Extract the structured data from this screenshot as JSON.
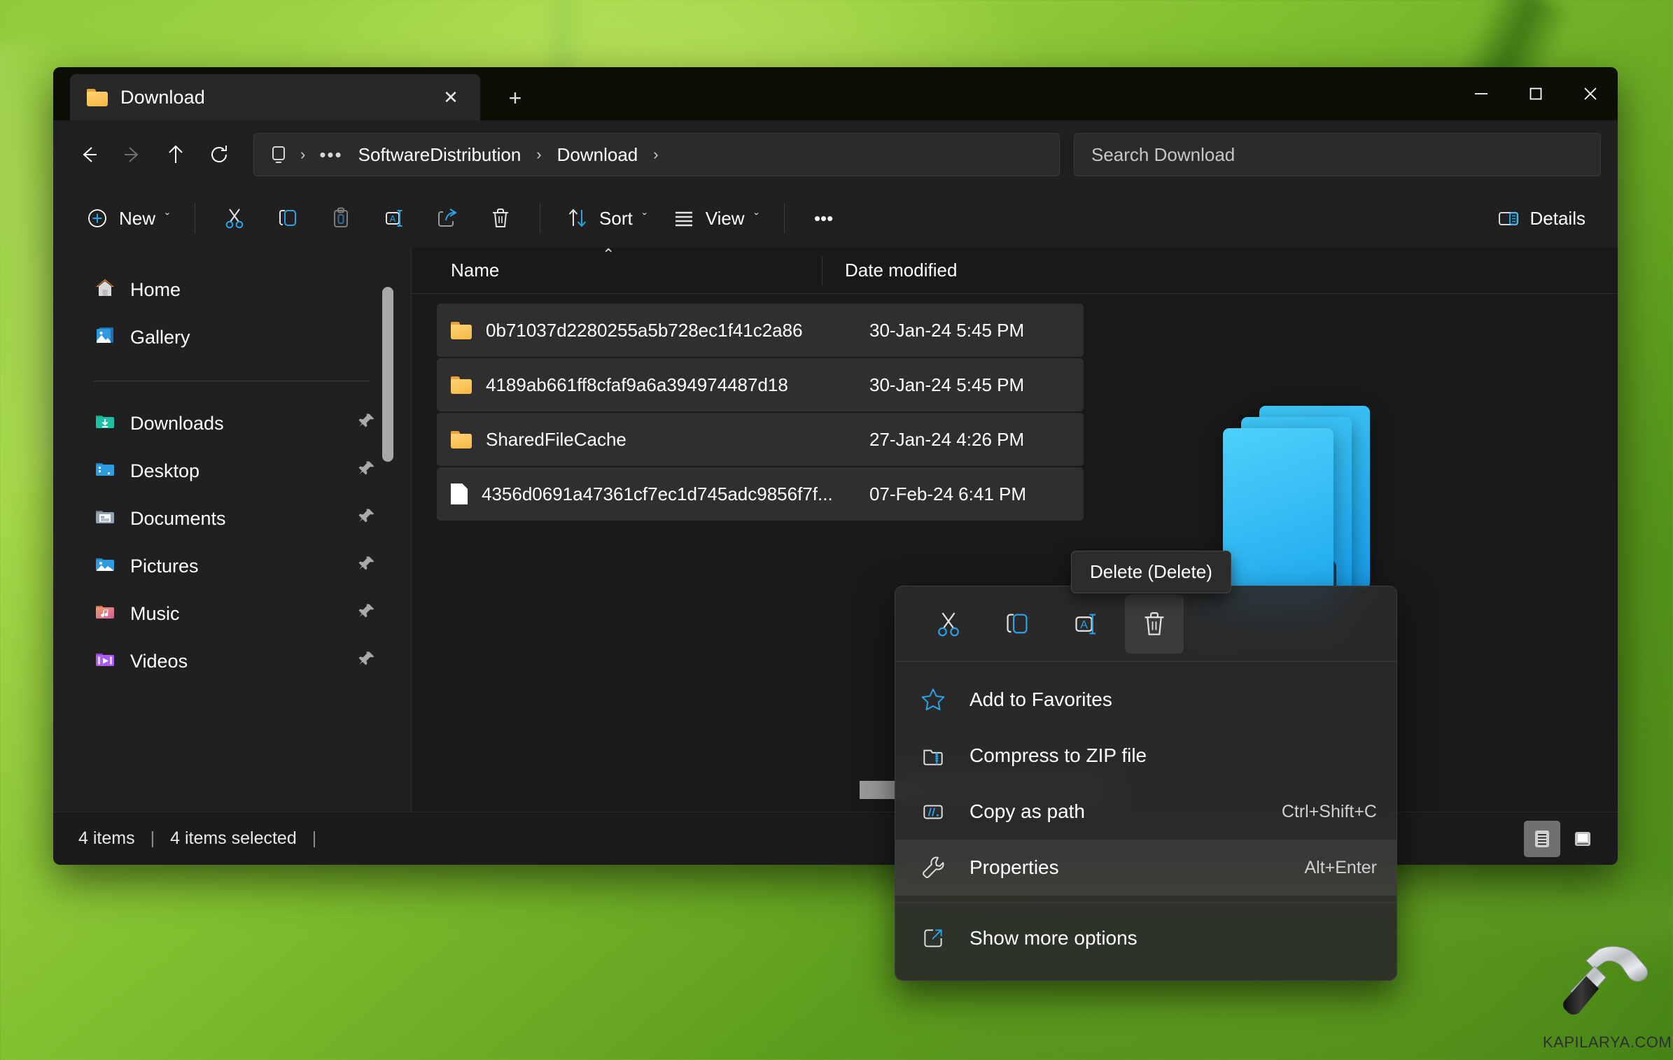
{
  "window": {
    "tab_title": "Download",
    "tab_close_glyph": "✕",
    "new_tab_glyph": "+",
    "minimize_label": "Minimize",
    "maximize_label": "Maximize",
    "close_label": "Close"
  },
  "nav": {
    "back": "Back",
    "forward": "Forward",
    "up": "Up",
    "refresh": "Refresh"
  },
  "breadcrumb": {
    "root_icon": "this-pc-icon",
    "overflow": "•••",
    "sep": "›",
    "items": [
      {
        "label": "SoftwareDistribution"
      },
      {
        "label": "Download"
      }
    ]
  },
  "search": {
    "placeholder": "Search Download",
    "value": ""
  },
  "toolbar": {
    "new_label": "New",
    "cut_label": "Cut",
    "copy_label": "Copy",
    "paste_label": "Paste",
    "rename_label": "Rename",
    "share_label": "Share",
    "delete_label": "Delete",
    "sort_label": "Sort",
    "view_label": "View",
    "more_label": "•••",
    "details_label": "Details",
    "chevron": "ˇ"
  },
  "sidebar": {
    "top_items": [
      {
        "label": "Home",
        "icon": "home-icon",
        "pinned": false
      },
      {
        "label": "Gallery",
        "icon": "gallery-icon",
        "pinned": false
      }
    ],
    "quick_access": [
      {
        "label": "Downloads",
        "icon": "downloads-folder-icon",
        "pinned": true
      },
      {
        "label": "Desktop",
        "icon": "desktop-folder-icon",
        "pinned": true
      },
      {
        "label": "Documents",
        "icon": "documents-folder-icon",
        "pinned": true
      },
      {
        "label": "Pictures",
        "icon": "pictures-folder-icon",
        "pinned": true
      },
      {
        "label": "Music",
        "icon": "music-folder-icon",
        "pinned": true
      },
      {
        "label": "Videos",
        "icon": "videos-folder-icon",
        "pinned": true
      }
    ],
    "pin_glyph": "📌"
  },
  "filelist": {
    "columns": [
      {
        "key": "name",
        "label": "Name",
        "sorted": true,
        "sort_dir": "asc",
        "sort_glyph": "⌃"
      },
      {
        "key": "date",
        "label": "Date modified",
        "sorted": false
      }
    ],
    "rows": [
      {
        "name": "0b71037d2280255a5b728ec1f41c2a86",
        "date": "30-Jan-24 5:45 PM",
        "type": "folder",
        "selected": true
      },
      {
        "name": "4189ab661ff8cfaf9a6a394974487d18",
        "date": "30-Jan-24 5:45 PM",
        "type": "folder",
        "selected": true
      },
      {
        "name": "SharedFileCache",
        "date": "27-Jan-24 4:26 PM",
        "type": "folder",
        "selected": true
      },
      {
        "name": "4356d0691a47361cf7ec1d745adc9856f7f...",
        "date": "07-Feb-24 6:41 PM",
        "type": "file",
        "selected": true
      }
    ]
  },
  "context_menu": {
    "icon_row": [
      {
        "name": "cut-icon",
        "label": "Cut",
        "hover": false
      },
      {
        "name": "copy-icon",
        "label": "Copy",
        "hover": false
      },
      {
        "name": "rename-icon",
        "label": "Rename",
        "hover": false
      },
      {
        "name": "delete-icon",
        "label": "Delete",
        "hover": true
      }
    ],
    "items": [
      {
        "label": "Add to Favorites",
        "shortcut": "",
        "icon": "star-icon",
        "highlighted": false
      },
      {
        "label": "Compress to ZIP file",
        "shortcut": "",
        "icon": "zip-icon",
        "highlighted": false
      },
      {
        "label": "Copy as path",
        "shortcut": "Ctrl+Shift+C",
        "icon": "copy-path-icon",
        "highlighted": false
      },
      {
        "label": "Properties",
        "shortcut": "Alt+Enter",
        "icon": "wrench-icon",
        "highlighted": true
      },
      {
        "label": "Show more options",
        "shortcut": "",
        "icon": "show-more-icon",
        "highlighted": false
      }
    ]
  },
  "tooltip": {
    "text": "Delete (Delete)"
  },
  "statusbar": {
    "item_count": "4 items",
    "selection": "4 items selected",
    "divider": "|",
    "view_details_label": "Details view",
    "view_large_label": "Large icons view"
  },
  "watermark": {
    "text": "KAPILARYA.COM",
    "icon": "hammer-icon"
  },
  "colors": {
    "accent": "#2aa3e8",
    "window_bg": "#202020",
    "list_bg": "#191919",
    "row_selected": "#2f2f2f",
    "menu_bg": "#2b2b2b",
    "folder_yellow": "#f5b740",
    "desktop_green": "#8fcb3a"
  }
}
